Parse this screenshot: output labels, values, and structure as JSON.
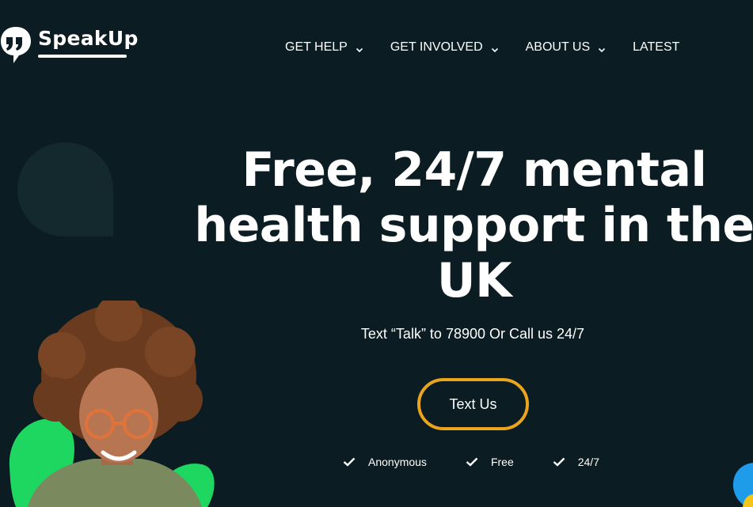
{
  "header": {
    "logo_text": "SpeakUp",
    "nav": [
      {
        "label": "GET HELP",
        "has_dropdown": true
      },
      {
        "label": "GET INVOLVED",
        "has_dropdown": true
      },
      {
        "label": "ABOUT US",
        "has_dropdown": true
      },
      {
        "label": "LATEST",
        "has_dropdown": false
      }
    ]
  },
  "hero": {
    "title": "Free, 24/7 mental health support in the UK",
    "subtitle": "Text  “Talk” to 78900 Or Call us 24/7",
    "cta_label": "Text Us",
    "features": [
      {
        "label": "Anonymous",
        "icon": "check-icon"
      },
      {
        "label": "Free",
        "icon": "check-icon"
      },
      {
        "label": "24/7",
        "icon": "check-icon"
      }
    ]
  },
  "colors": {
    "background": "#0b1d22",
    "accent_ring": "#eba41e",
    "blob_green": "#1ed760",
    "blob_blue": "#1e9be9",
    "bubble": "#14292e"
  }
}
